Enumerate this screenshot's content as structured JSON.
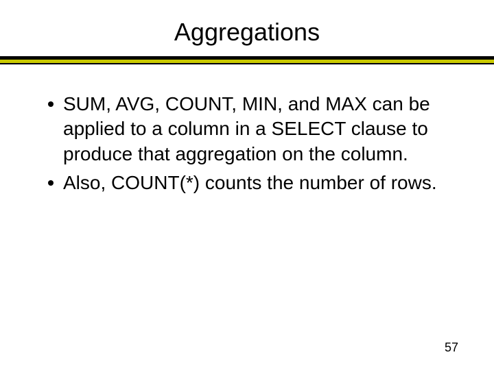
{
  "title": "Aggregations",
  "bullets": [
    "SUM, AVG, COUNT, MIN, and MAX can be applied to a column in a SELECT clause to produce that aggregation on the column.",
    "Also, COUNT(*) counts the number of rows."
  ],
  "page_number": "57"
}
